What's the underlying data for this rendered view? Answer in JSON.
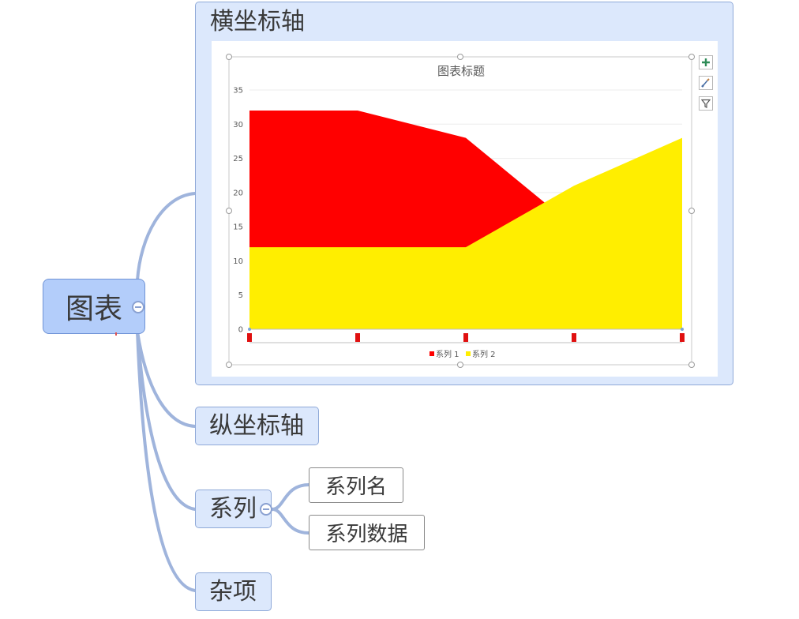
{
  "root": {
    "label": "图表"
  },
  "branches": {
    "x_axis": {
      "label": "横坐标轴"
    },
    "y_axis": {
      "label": "纵坐标轴"
    },
    "series": {
      "label": "系列",
      "children": [
        {
          "label": "系列名"
        },
        {
          "label": "系列数据"
        }
      ]
    },
    "misc": {
      "label": "杂项"
    }
  },
  "chart_tools": [
    "plus-icon",
    "brush-icon",
    "filter-icon"
  ],
  "chart_data": {
    "type": "area",
    "title": "图表标题",
    "xlabel": "",
    "ylabel": "",
    "ylim": [
      0,
      35
    ],
    "yticks": [
      0,
      5,
      10,
      15,
      20,
      25,
      30,
      35
    ],
    "categories": [
      "",
      "",
      "",
      "",
      ""
    ],
    "grid": true,
    "legend_position": "bottom",
    "series": [
      {
        "name": "系列 1",
        "color": "#ff0000",
        "values": [
          32,
          32,
          28,
          15,
          8
        ]
      },
      {
        "name": "系列 2",
        "color": "#ffee00",
        "values": [
          12,
          12,
          12,
          21,
          28
        ]
      }
    ]
  }
}
